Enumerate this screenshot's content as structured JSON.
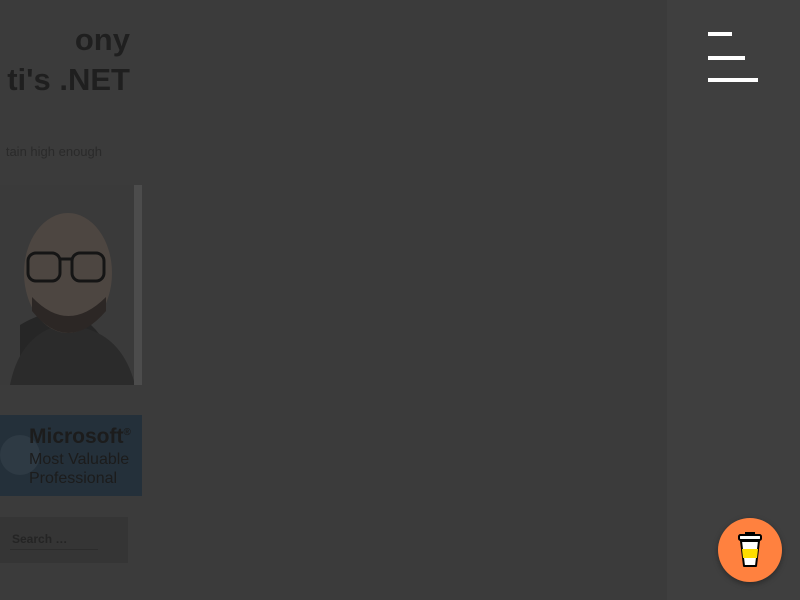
{
  "sidebar": {
    "title_line1": "ony",
    "title_line2": "ti's .NET",
    "tagline": "tain high enough",
    "mvp_badge": {
      "line1": "Microsoft",
      "line1_mark": "®",
      "line2": "Most Valuable",
      "line3": "Professional"
    },
    "search": {
      "placeholder": "Search …"
    }
  },
  "menu": {
    "icon": "hamburger-menu-icon"
  },
  "buy_me_a_coffee": {
    "icon": "coffee-cup-icon",
    "color": "#ff813f"
  },
  "colors": {
    "overlay_background": "#3b3b3b",
    "panel_background": "#3f3f3f",
    "accent": "#ff813f"
  }
}
